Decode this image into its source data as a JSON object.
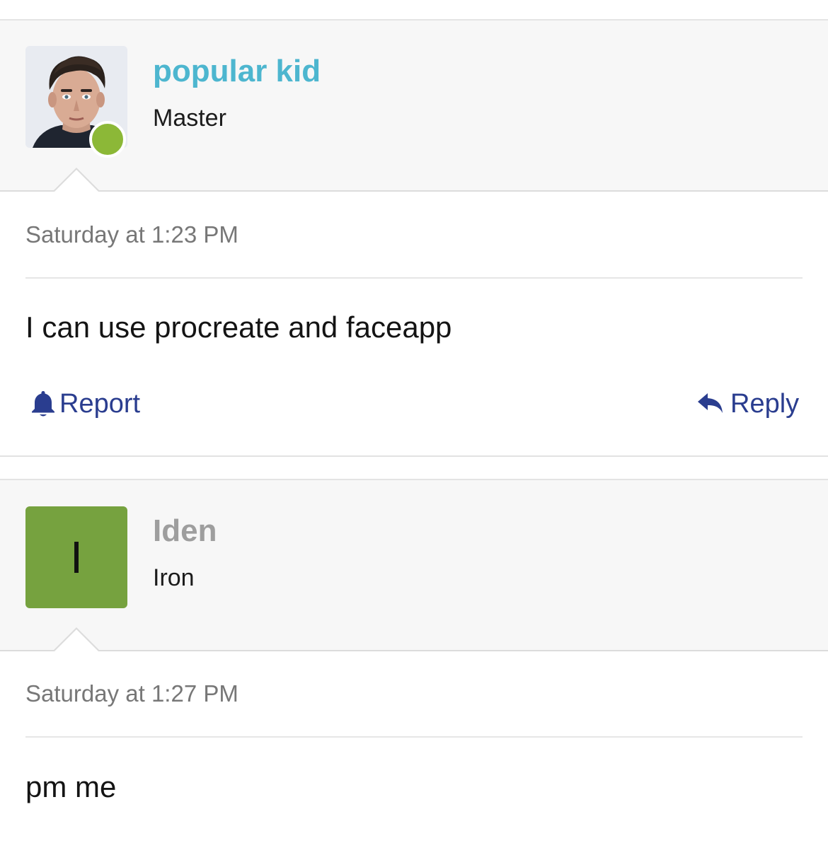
{
  "posts": [
    {
      "username": "popular kid",
      "rank": "Master",
      "avatar_type": "photo",
      "online": true,
      "timestamp": "Saturday at 1:23 PM",
      "message": "I can use procreate and faceapp",
      "actions": {
        "report_label": "Report",
        "reply_label": "Reply"
      }
    },
    {
      "username": "Iden",
      "rank": "Iron",
      "avatar_type": "letter",
      "avatar_letter": "I",
      "timestamp": "Saturday at 1:27 PM",
      "message": "pm me"
    }
  ],
  "colors": {
    "username_active": "#4db6cf",
    "username_inactive": "#9e9e9e",
    "online_dot": "#8cb837",
    "letter_avatar_bg": "#76a23f",
    "action_link": "#2a3d8f"
  },
  "icons": {
    "report": "bell-icon",
    "reply": "reply-arrow-icon"
  }
}
